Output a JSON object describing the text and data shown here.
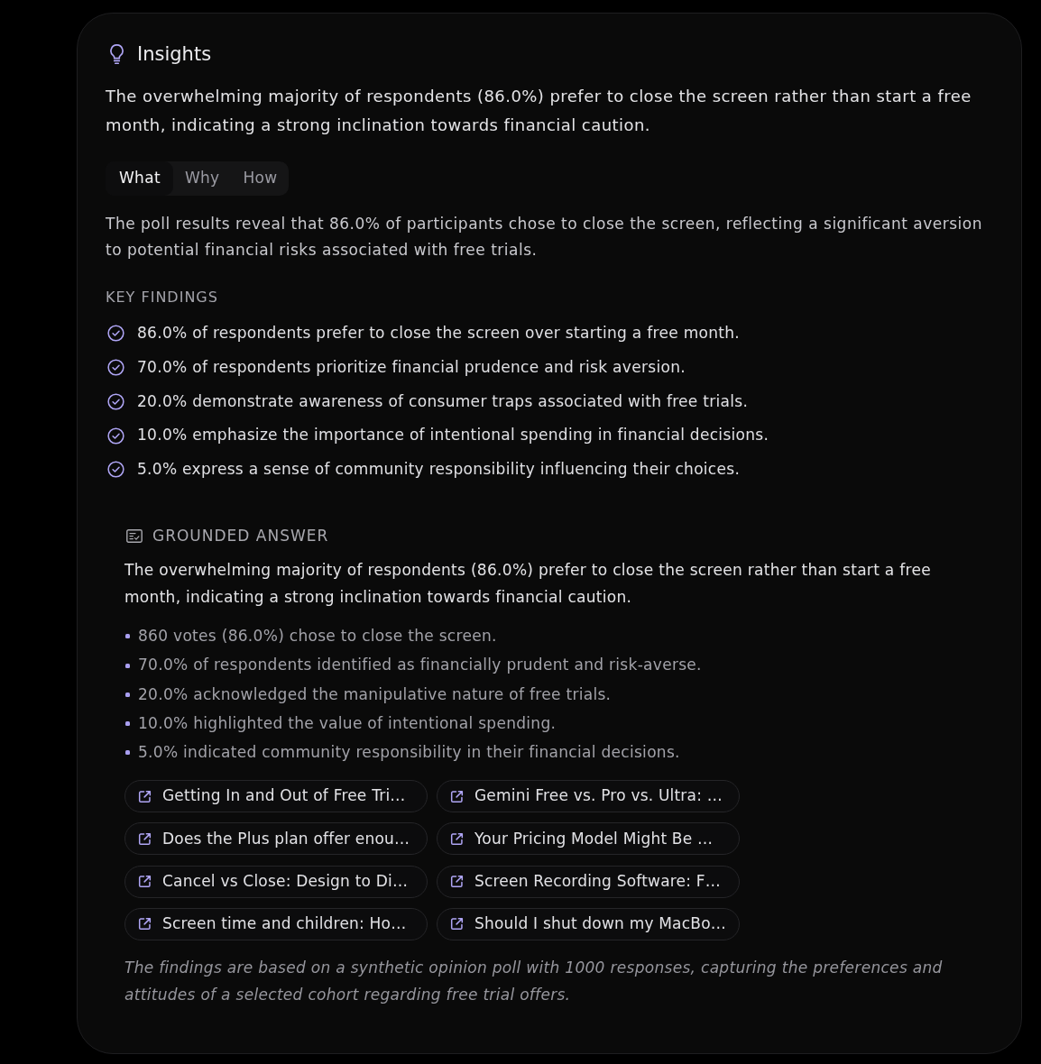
{
  "panel": {
    "title": "Insights",
    "summary": "The overwhelming majority of respondents (86.0%) prefer to close the screen rather than start a free month, indicating a strong inclination towards financial caution."
  },
  "tabs": [
    {
      "label": "What",
      "selected": true
    },
    {
      "label": "Why",
      "selected": false
    },
    {
      "label": "How",
      "selected": false
    }
  ],
  "tab_content": "The poll results reveal that 86.0% of participants chose to close the screen, reflecting a significant aversion to potential financial risks associated with free trials.",
  "key_findings": {
    "heading": "KEY FINDINGS",
    "items": [
      "86.0% of respondents prefer to close the screen over starting a free month.",
      "70.0% of respondents prioritize financial prudence and risk aversion.",
      "20.0% demonstrate awareness of consumer traps associated with free trials.",
      "10.0% emphasize the importance of intentional spending in financial decisions.",
      "5.0% express a sense of community responsibility influencing their choices."
    ]
  },
  "grounded_answer": {
    "heading": "GROUNDED ANSWER",
    "text": "The overwhelming majority of respondents (86.0%) prefer to close the screen rather than start a free month, indicating a strong inclination towards financial caution.",
    "bullets": [
      "860 votes (86.0%) chose to close the screen.",
      "70.0% of respondents identified as financially prudent and risk-averse.",
      "20.0% acknowledged the manipulative nature of free trials.",
      "10.0% highlighted the value of intentional spending.",
      "5.0% indicated community responsibility in their financial decisions."
    ],
    "sources": [
      "Getting In and Out of Free Tri…",
      "Gemini Free vs. Pro vs. Ultra: …",
      "Does the Plus plan offer enou…",
      "Your Pricing Model Might Be …",
      "Cancel vs Close: Design to Di…",
      "Screen Recording Software: F…",
      "Screen time and children: Ho…",
      "Should I shut down my MacBo…"
    ]
  },
  "footnote": "The findings are based on a synthetic opinion poll with 1000 responses, capturing the preferences and attitudes of a selected cohort regarding free trial offers."
}
